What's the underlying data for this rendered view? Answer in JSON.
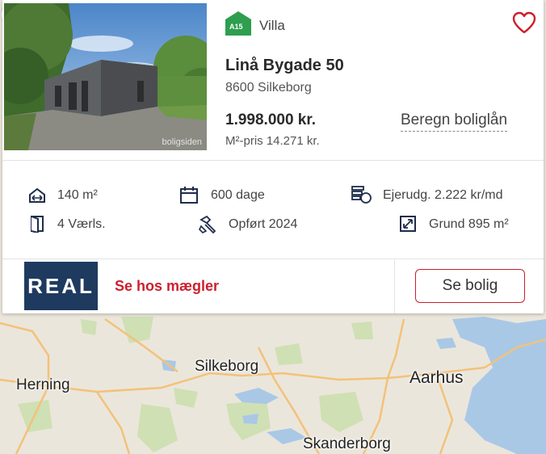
{
  "listing": {
    "energy_label": "A15",
    "property_type": "Villa",
    "address": "Linå Bygade 50",
    "postal_city": "8600 Silkeborg",
    "price": "1.998.000 kr.",
    "price_per_m2": "M²-pris 14.271 kr.",
    "loan_link": "Beregn boliglån",
    "photo_watermark": "boligsiden",
    "favorite_icon": "heart-icon"
  },
  "features": {
    "area": "140 m²",
    "days": "600 dage",
    "ownership_cost": "Ejerudg. 2.222 kr/md",
    "rooms": "4 Værls.",
    "built": "Opført 2024",
    "plot": "Grund 895 m²"
  },
  "broker": {
    "logo_text": "REAL",
    "link": "Se hos mægler",
    "button": "Se bolig"
  },
  "colors": {
    "accent": "#cc1f2d",
    "energy_green": "#2e9e4f",
    "logo_bg": "#1f3a5f"
  },
  "map": {
    "cities": [
      "Herning",
      "Silkeborg",
      "Aarhus",
      "Skanderborg"
    ]
  }
}
